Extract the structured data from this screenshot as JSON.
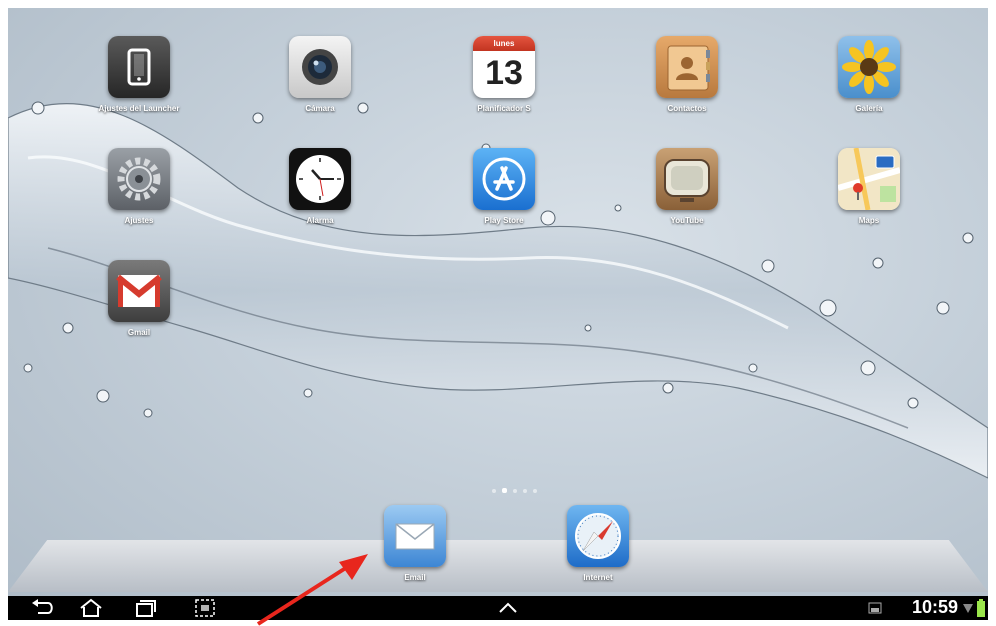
{
  "apps": [
    {
      "label": "Ajustes del Launcher",
      "icon": "phone-settings-icon"
    },
    {
      "label": "Cámara",
      "icon": "camera-icon"
    },
    {
      "label": "Planificador S",
      "icon": "calendar-icon",
      "calendar_day_name": "lunes",
      "calendar_day_number": "13"
    },
    {
      "label": "Contactos",
      "icon": "contacts-book-icon"
    },
    {
      "label": "Galería",
      "icon": "sunflower-gallery-icon"
    },
    {
      "label": "Ajustes",
      "icon": "gears-icon"
    },
    {
      "label": "Alarma",
      "icon": "clock-icon"
    },
    {
      "label": "Play Store",
      "icon": "app-store-icon"
    },
    {
      "label": "YouTube",
      "icon": "tv-icon"
    },
    {
      "label": "Maps",
      "icon": "map-icon"
    },
    {
      "label": "Gmail",
      "icon": "gmail-icon"
    }
  ],
  "dock": [
    {
      "label": "Email",
      "icon": "envelope-icon"
    },
    {
      "label": "Internet",
      "icon": "compass-icon"
    }
  ],
  "page_indicator": {
    "count": 5,
    "active": 2
  },
  "status": {
    "time": "10:59"
  },
  "colors": {
    "accent_arrow": "#e8261d",
    "navbar": "#000000",
    "battery": "#9be64b"
  }
}
